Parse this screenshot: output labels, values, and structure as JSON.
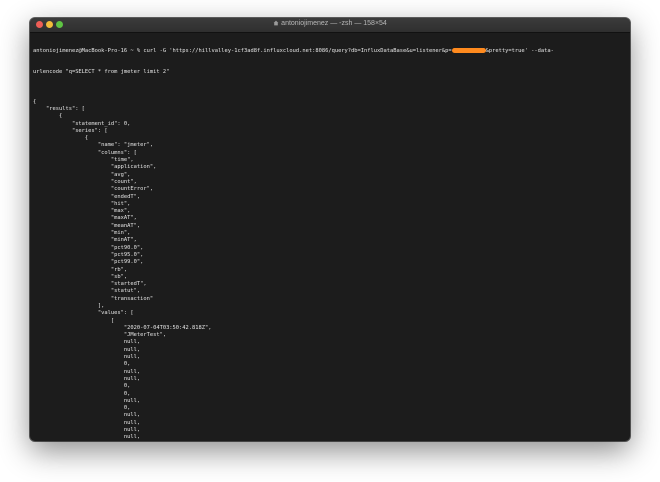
{
  "window": {
    "title": "antoniojimenez — -zsh — 158×54"
  },
  "terminal": {
    "prompt_line1_before": "antoniojimenez@MacBook-Pro-16 ~ % curl -G 'https://hillvalley-1cf3ad8f.influxcloud.net:8086/query?db=InfluxDataBase&u=listener&p=",
    "prompt_line1_after": "&pretty=true' --data-",
    "prompt_line2": "urlencode \"q=SELECT * from jmeter limit 2\"",
    "output_lines": [
      "",
      "{",
      "    \"results\": [",
      "        {",
      "            \"statement_id\": 0,",
      "            \"series\": [",
      "                {",
      "                    \"name\": \"jmeter\",",
      "                    \"columns\": [",
      "                        \"time\",",
      "                        \"application\",",
      "                        \"avg\",",
      "                        \"count\",",
      "                        \"countError\",",
      "                        \"endedT\",",
      "                        \"hit\",",
      "                        \"max\",",
      "                        \"maxAT\",",
      "                        \"meanAT\",",
      "                        \"min\",",
      "                        \"minAT\",",
      "                        \"pct90.0\",",
      "                        \"pct95.0\",",
      "                        \"pct99.0\",",
      "                        \"rb\",",
      "                        \"sb\",",
      "                        \"startedT\",",
      "                        \"statut\",",
      "                        \"transaction\"",
      "                    ],",
      "                    \"values\": [",
      "                        [",
      "                            \"2020-07-04T03:50:42.818Z\",",
      "                            \"JMeterTest\",",
      "                            null,",
      "                            null,",
      "                            null,",
      "                            0,",
      "                            null,",
      "                            null,",
      "                            0,",
      "                            0,",
      "                            null,",
      "                            0,",
      "                            null,",
      "                            null,",
      "                            null,",
      "                            null,",
      "                            null,",
      "                            0,",
      "                            null,",
      "                            \"internal\""
    ]
  }
}
